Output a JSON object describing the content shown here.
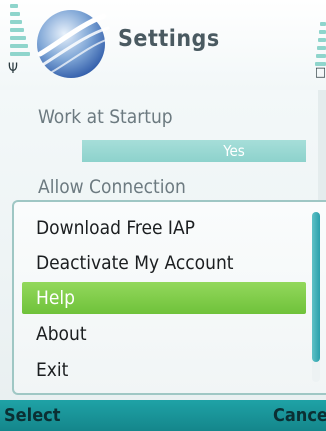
{
  "title_bar": {
    "title": "Settings",
    "logo_icon": "app-logo-icon",
    "signal_icon": "signal-strength-icon",
    "battery_icon": "battery-level-icon",
    "antenna_glyph": "Ψ",
    "battery_glyph": "□"
  },
  "settings": [
    {
      "label": "Work at Startup",
      "value": "Yes"
    },
    {
      "label": "Allow Connection"
    }
  ],
  "options_menu": {
    "items": [
      {
        "label": "Download Free IAP",
        "selected": false
      },
      {
        "label": "Deactivate My Account",
        "selected": false
      },
      {
        "label": "Help",
        "selected": true
      },
      {
        "label": "About",
        "selected": false
      },
      {
        "label": "Exit",
        "selected": false
      }
    ]
  },
  "softkeys": {
    "left": "Select",
    "right": "Cancel"
  },
  "colors": {
    "accent": "#1fa2a6",
    "selection": "#7dc948",
    "value_bar": "#8dd2cc"
  }
}
